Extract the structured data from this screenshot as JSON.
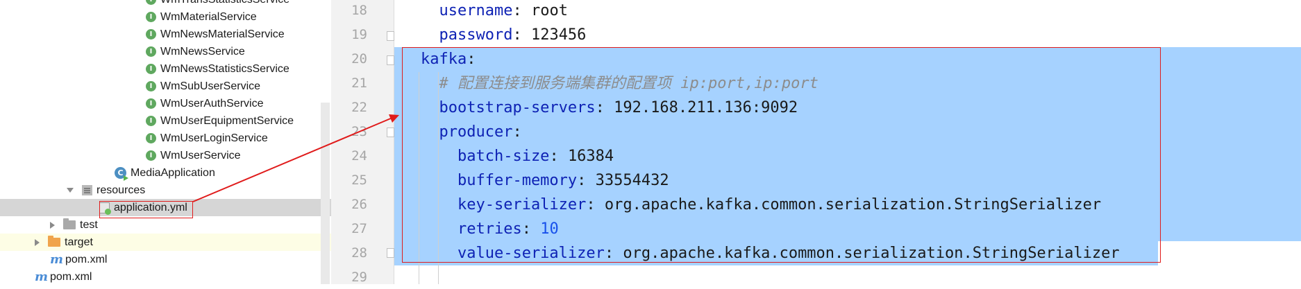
{
  "tree": {
    "items": [
      {
        "label": "WmTransStatisticsService",
        "icon": "interface-icon"
      },
      {
        "label": "WmMaterialService",
        "icon": "interface-icon"
      },
      {
        "label": "WmNewsMaterialService",
        "icon": "interface-icon"
      },
      {
        "label": "WmNewsService",
        "icon": "interface-icon"
      },
      {
        "label": "WmNewsStatisticsService",
        "icon": "interface-icon"
      },
      {
        "label": "WmSubUserService",
        "icon": "interface-icon"
      },
      {
        "label": "WmUserAuthService",
        "icon": "interface-icon"
      },
      {
        "label": "WmUserEquipmentService",
        "icon": "interface-icon"
      },
      {
        "label": "WmUserLoginService",
        "icon": "interface-icon"
      },
      {
        "label": "WmUserService",
        "icon": "interface-icon"
      },
      {
        "label": "MediaApplication",
        "icon": "spring-boot-class-icon"
      },
      {
        "label": "resources",
        "icon": "resources-folder-icon",
        "expanded": true
      },
      {
        "label": "application.yml",
        "icon": "yaml-file-icon",
        "selected": true
      },
      {
        "label": "test",
        "icon": "folder-icon",
        "expanded": false
      },
      {
        "label": "target",
        "icon": "folder-icon",
        "expanded": false
      },
      {
        "label": "pom.xml",
        "icon": "maven-icon"
      },
      {
        "label": "pom.xml",
        "icon": "maven-icon"
      }
    ],
    "interface_glyph": "I",
    "class_glyph": "C",
    "maven_glyph": "m"
  },
  "editor": {
    "lines": [
      {
        "num": "18",
        "tokens": [
          [
            "k",
            "  username"
          ],
          [
            "p",
            ": "
          ],
          [
            "v",
            "root"
          ]
        ]
      },
      {
        "num": "19",
        "tokens": [
          [
            "k",
            "  password"
          ],
          [
            "p",
            ": "
          ],
          [
            "v",
            "123456"
          ]
        ]
      },
      {
        "num": "20",
        "tokens": [
          [
            "k",
            "kafka"
          ],
          [
            "p",
            ":"
          ]
        ]
      },
      {
        "num": "21",
        "tokens": [
          [
            "c",
            "  # 配置连接到服务端集群的配置项 ip:port,ip:port"
          ]
        ]
      },
      {
        "num": "22",
        "tokens": [
          [
            "k",
            "  bootstrap-servers"
          ],
          [
            "p",
            ": "
          ],
          [
            "v",
            "192.168.211.136:9092"
          ]
        ]
      },
      {
        "num": "23",
        "tokens": [
          [
            "k",
            "  producer"
          ],
          [
            "p",
            ":"
          ]
        ]
      },
      {
        "num": "24",
        "tokens": [
          [
            "k",
            "    batch-size"
          ],
          [
            "p",
            ": "
          ],
          [
            "v",
            "16384"
          ]
        ]
      },
      {
        "num": "25",
        "tokens": [
          [
            "k",
            "    buffer-memory"
          ],
          [
            "p",
            ": "
          ],
          [
            "v",
            "33554432"
          ]
        ]
      },
      {
        "num": "26",
        "tokens": [
          [
            "k",
            "    key-serializer"
          ],
          [
            "p",
            ": "
          ],
          [
            "v",
            "org.apache.kafka.common.serialization.StringSerializer"
          ]
        ]
      },
      {
        "num": "27",
        "tokens": [
          [
            "k",
            "    retries"
          ],
          [
            "p",
            ": "
          ],
          [
            "n",
            "10"
          ]
        ]
      },
      {
        "num": "28",
        "tokens": [
          [
            "k",
            "    value-serializer"
          ],
          [
            "p",
            ": "
          ],
          [
            "v",
            "org.apache.kafka.common.serialization.StringSerializer"
          ]
        ]
      },
      {
        "num": "29",
        "tokens": []
      }
    ],
    "selection": "lines 20-28",
    "colors": {
      "key": "#0e22b4",
      "value": "#1a1a1a",
      "number": "#1750eb",
      "comment": "#8c8c8c",
      "selection": "#a6d2ff",
      "annotation": "#e01b1b"
    }
  }
}
